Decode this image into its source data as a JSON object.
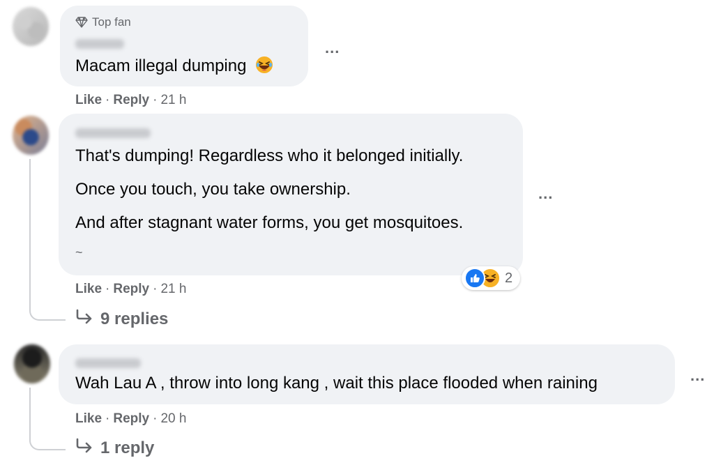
{
  "comments": [
    {
      "badge": "Top fan",
      "lines": [
        "Macam illegal dumping"
      ],
      "emoji": "haha-emoji",
      "actions": {
        "like": "Like",
        "reply": "Reply",
        "time": "21 h"
      }
    },
    {
      "lines": [
        "That's dumping! Regardless who it belonged initially.",
        "Once you touch, you take ownership.",
        "And after stagnant water forms, you get mosquitoes.",
        "~"
      ],
      "reaction_count": "2",
      "actions": {
        "like": "Like",
        "reply": "Reply",
        "time": "21 h"
      },
      "replies_label": "9 replies"
    },
    {
      "lines": [
        "Wah Lau A , throw into long kang , wait this place flooded when raining"
      ],
      "actions": {
        "like": "Like",
        "reply": "Reply",
        "time": "20 h"
      },
      "replies_label": "1 reply"
    }
  ],
  "ui": {
    "more_label": "...",
    "separator": "·"
  },
  "colors": {
    "bubble": "#f0f2f5",
    "secondary_text": "#65676b",
    "like_blue": "#1877f2",
    "haha_yellow": "#f7b125"
  },
  "icons": [
    "diamond-icon",
    "more-options-icon",
    "reply-arrow-icon",
    "like-reaction-icon",
    "haha-reaction-icon"
  ]
}
